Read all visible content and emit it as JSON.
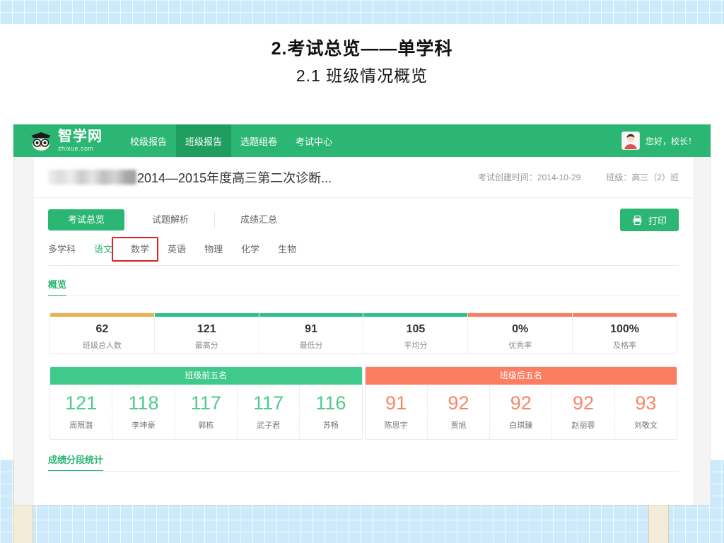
{
  "slide": {
    "title": "2.考试总览——单学科",
    "subtitle": "2.1  班级情况概览"
  },
  "nav": {
    "logo_name": "智学网",
    "logo_domain": "zhixue.com",
    "items": [
      {
        "label": "校级报告",
        "active": false
      },
      {
        "label": "班级报告",
        "active": true
      },
      {
        "label": "选题组卷",
        "active": false
      },
      {
        "label": "考试中心",
        "active": false
      }
    ],
    "user_greeting": "您好，校长！"
  },
  "exam": {
    "title": "2014—2015年度高三第二次诊断...",
    "created_label": "考试创建时间：2014-10-29",
    "class_label": "班级：高三（2）班"
  },
  "tabs": {
    "main": [
      {
        "label": "考试总览",
        "active": true
      },
      {
        "label": "试题解析",
        "active": false
      },
      {
        "label": "成绩汇总",
        "active": false
      }
    ],
    "print_label": "打印"
  },
  "subjects": [
    {
      "label": "多学科",
      "active": false
    },
    {
      "label": "语文",
      "active": true
    },
    {
      "label": "数学",
      "active": false
    },
    {
      "label": "英语",
      "active": false
    },
    {
      "label": "物理",
      "active": false
    },
    {
      "label": "化学",
      "active": false
    },
    {
      "label": "生物",
      "active": false
    }
  ],
  "overview": {
    "section_title": "概览",
    "stats": [
      {
        "value": "62",
        "label": "班级总人数",
        "bar_color": "#e8b252"
      },
      {
        "value": "121",
        "label": "最高分",
        "bar_color": "#2fc08a"
      },
      {
        "value": "91",
        "label": "最低分",
        "bar_color": "#2fc08a"
      },
      {
        "value": "105",
        "label": "平均分",
        "bar_color": "#2fc08a"
      },
      {
        "value": "0%",
        "label": "优秀率",
        "bar_color": "#fa7c62"
      },
      {
        "value": "100%",
        "label": "及格率",
        "bar_color": "#fa7c62"
      }
    ]
  },
  "ranks": {
    "top": {
      "header": "班级前五名",
      "header_color": "#3fc98a",
      "score_color": "#4ecb8d",
      "rows": [
        {
          "score": "121",
          "name": "周照潞"
        },
        {
          "score": "118",
          "name": "李坤豪"
        },
        {
          "score": "117",
          "name": "郭栋"
        },
        {
          "score": "117",
          "name": "武子君"
        },
        {
          "score": "116",
          "name": "苏畅"
        }
      ]
    },
    "bottom": {
      "header": "班级后五名",
      "header_color": "#fb7e63",
      "score_color": "#fa8566",
      "rows": [
        {
          "score": "91",
          "name": "陈思宇"
        },
        {
          "score": "92",
          "name": "贾旭"
        },
        {
          "score": "92",
          "name": "白琪臻"
        },
        {
          "score": "92",
          "name": "赵丽蓉"
        },
        {
          "score": "93",
          "name": "刘敬文"
        }
      ]
    }
  },
  "distribution": {
    "section_title": "成绩分段统计"
  }
}
